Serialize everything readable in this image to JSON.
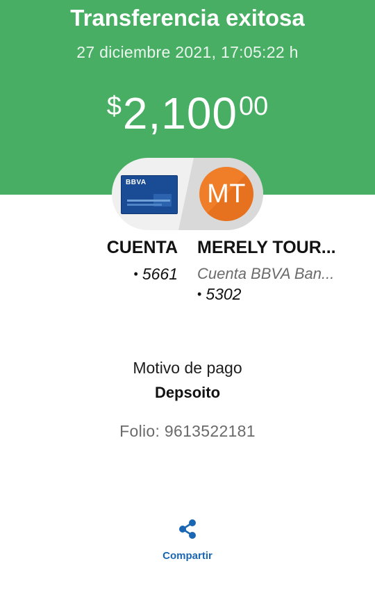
{
  "header": {
    "title": "Transferencia exitosa",
    "datetime": "27 diciembre 2021, 17:05:22 h",
    "amount": {
      "currency_symbol": "$",
      "integer": "2,100",
      "cents": "00"
    }
  },
  "from": {
    "card_logo": "BBVA",
    "name": "CUENTA",
    "account": "5661"
  },
  "to": {
    "initials": "MT",
    "name": "MERELY TOUR...",
    "bank": "Cuenta BBVA Ban...",
    "account": "5302"
  },
  "details": {
    "motivo_label": "Motivo de pago",
    "motivo_value": "Depsoito",
    "folio": "Folio: 9613522181"
  },
  "actions": {
    "share_label": "Compartir",
    "share_icon": "share-icon"
  },
  "colors": {
    "header_bg": "#48ae64",
    "avatar_bg": "#f07e28",
    "card_bg": "#1a4c96",
    "link": "#1a66b3"
  },
  "account_bullet": "•"
}
